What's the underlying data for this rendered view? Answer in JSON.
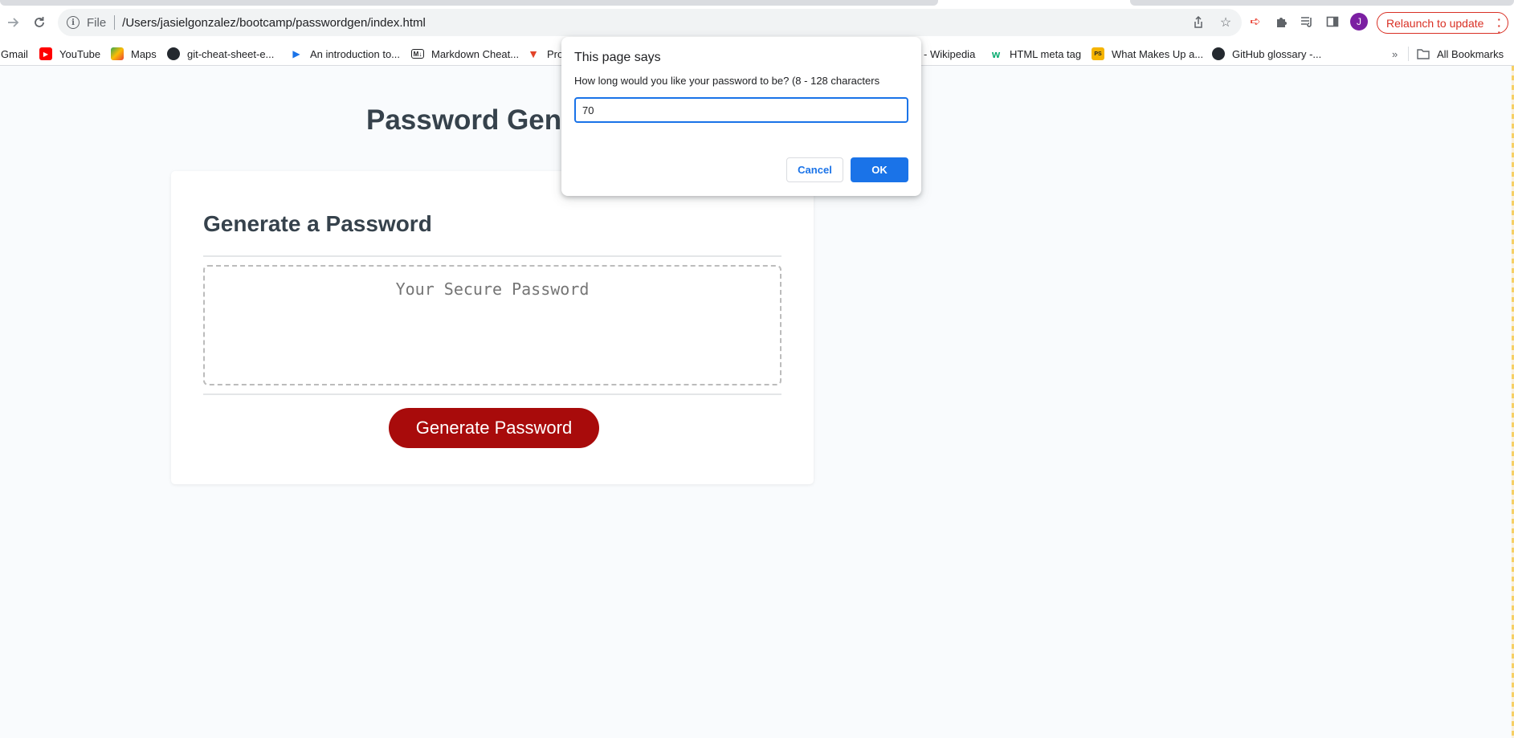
{
  "browser": {
    "url_scheme_label": "File",
    "url": "/Users/jasielgonzalez/bootcamp/passwordgen/index.html",
    "relaunch_label": "Relaunch to update",
    "profile_initial": "J"
  },
  "bookmarks": {
    "items": [
      {
        "label": "Gmail",
        "icon": "none"
      },
      {
        "label": "YouTube",
        "icon": "youtube-icon"
      },
      {
        "label": "Maps",
        "icon": "maps-icon"
      },
      {
        "label": "git-cheat-sheet-e...",
        "icon": "github-icon"
      },
      {
        "label": "An introduction to...",
        "icon": "video-icon"
      },
      {
        "label": "Markdown Cheat...",
        "icon": "markdown-icon"
      },
      {
        "label": "Pro",
        "icon": "gitlab-icon"
      },
      {
        "label": "- Wikipedia",
        "icon": "none"
      },
      {
        "label": "HTML meta tag",
        "icon": "w-icon"
      },
      {
        "label": "What Makes Up a...",
        "icon": "ps-icon"
      },
      {
        "label": "GitHub glossary -...",
        "icon": "github-icon"
      }
    ],
    "overflow_label": "»",
    "all_bookmarks_label": "All Bookmarks"
  },
  "page": {
    "title": "Password Gene",
    "card_title": "Generate a Password",
    "password_placeholder": "Your Secure Password",
    "generate_button": "Generate Password"
  },
  "dialog": {
    "title": "This page says",
    "message": "How long would you like your password to be? (8 - 128 characters",
    "input_value": "70",
    "cancel_label": "Cancel",
    "ok_label": "OK"
  },
  "colors": {
    "generate_button": "#a80b0b",
    "ok_button": "#1a73e8",
    "relaunch": "#d93025",
    "heading": "#36424c"
  }
}
